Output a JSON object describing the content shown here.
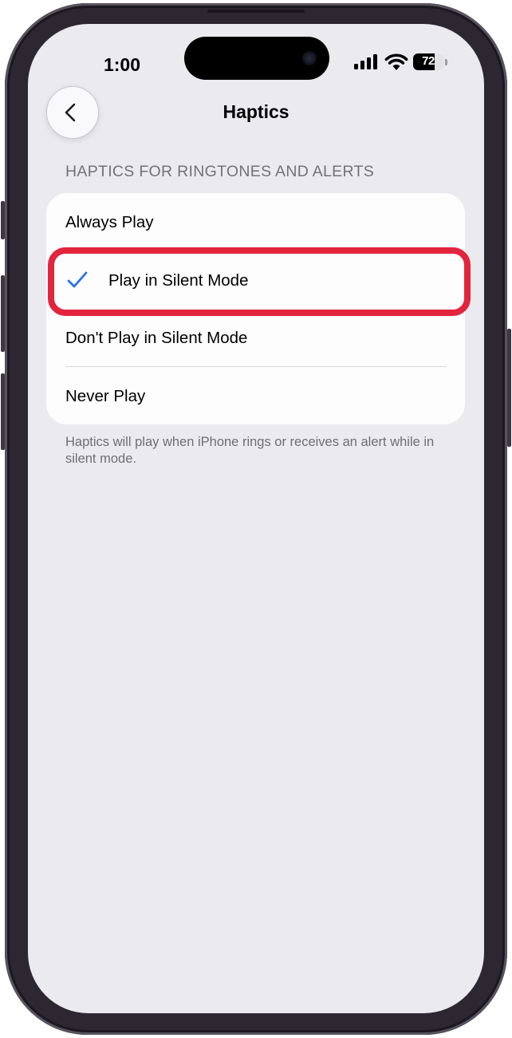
{
  "status_bar": {
    "time": "1:00",
    "battery_percent": "72",
    "battery_level": 0.72
  },
  "navigation": {
    "title": "Haptics",
    "back_icon": "chevron-left-icon"
  },
  "section": {
    "header": "HAPTICS FOR RINGTONES AND ALERTS",
    "options": [
      {
        "label": "Always Play",
        "selected": false
      },
      {
        "label": "Play in Silent Mode",
        "selected": true
      },
      {
        "label": "Don't Play in Silent Mode",
        "selected": false
      },
      {
        "label": "Never Play",
        "selected": false
      }
    ],
    "footer": "Haptics will play when iPhone rings or receives an alert while in silent mode."
  },
  "colors": {
    "checkmark": "#2a6ff0",
    "highlight": "#e3243d",
    "background": "#ebeaef"
  }
}
